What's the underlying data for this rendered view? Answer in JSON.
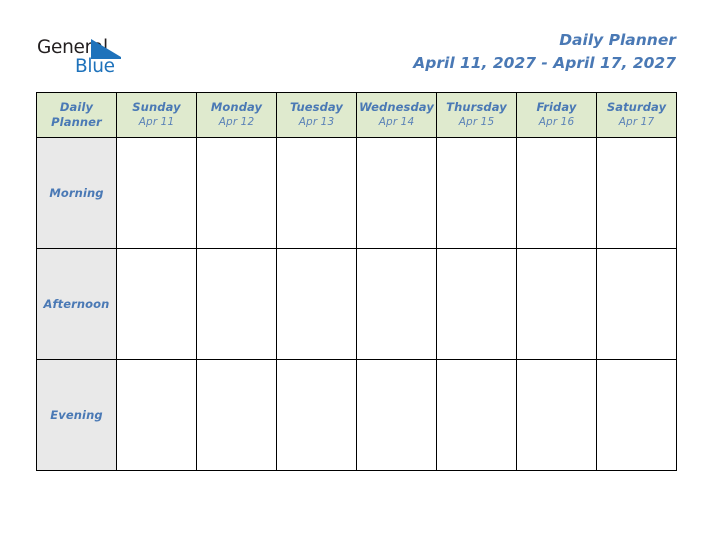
{
  "brand": {
    "logo_word1": "General",
    "logo_word2": "Blue",
    "logo_mark": "blue-triangle-icon",
    "logo_word1_color": "#231f20",
    "logo_word2_color": "#1e72bb"
  },
  "header": {
    "title": "Daily Planner",
    "date_range": "April 11, 2027 - April 17, 2027",
    "title_color": "#4a79b5"
  },
  "table": {
    "corner": {
      "line1": "Daily",
      "line2": "Planner"
    },
    "header_bg": "#dfeace",
    "label_bg": "#e9e9e9",
    "border_color": "#000000",
    "columns": [
      {
        "day": "Sunday",
        "date": "Apr 11"
      },
      {
        "day": "Monday",
        "date": "Apr 12"
      },
      {
        "day": "Tuesday",
        "date": "Apr 13"
      },
      {
        "day": "Wednesday",
        "date": "Apr 14"
      },
      {
        "day": "Thursday",
        "date": "Apr 15"
      },
      {
        "day": "Friday",
        "date": "Apr 16"
      },
      {
        "day": "Saturday",
        "date": "Apr 17"
      }
    ],
    "rows": [
      {
        "label": "Morning",
        "cells": [
          "",
          "",
          "",
          "",
          "",
          "",
          ""
        ]
      },
      {
        "label": "Afternoon",
        "cells": [
          "",
          "",
          "",
          "",
          "",
          "",
          ""
        ]
      },
      {
        "label": "Evening",
        "cells": [
          "",
          "",
          "",
          "",
          "",
          "",
          ""
        ]
      }
    ]
  }
}
